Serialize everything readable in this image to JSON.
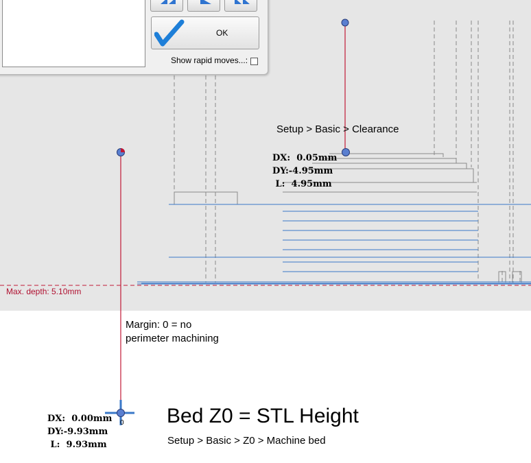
{
  "dialog": {
    "ok_label": "OK",
    "show_rapid_label": "Show rapid moves...:",
    "show_rapid_checked": false
  },
  "viewport": {
    "max_depth_label": "Max. depth: 5.10mm",
    "clearance_hint": "Setup > Basic > Clearance",
    "margin_hint_line1": "Margin: 0 = no",
    "margin_hint_line2": "perimeter machining",
    "bed_title": "Bed Z0 = STL Height",
    "bed_hint": "Setup > Basic > Z0 > Machine bed",
    "origin_label": "0",
    "measure_top": {
      "dx": "DX:  0.05mm",
      "dy": "DY:-4.95mm",
      "l": " L:  4.95mm"
    },
    "measure_bottom": {
      "dx": "DX:  0.00mm",
      "dy": "DY:-9.93mm",
      "l": " L:  9.93mm"
    }
  },
  "colors": {
    "bed": "#e6e6e6",
    "toolpath": "#3a78c8",
    "measure_line": "#c01835",
    "handle": "#5a7fd0",
    "ok_check": "#1e7fd8"
  }
}
